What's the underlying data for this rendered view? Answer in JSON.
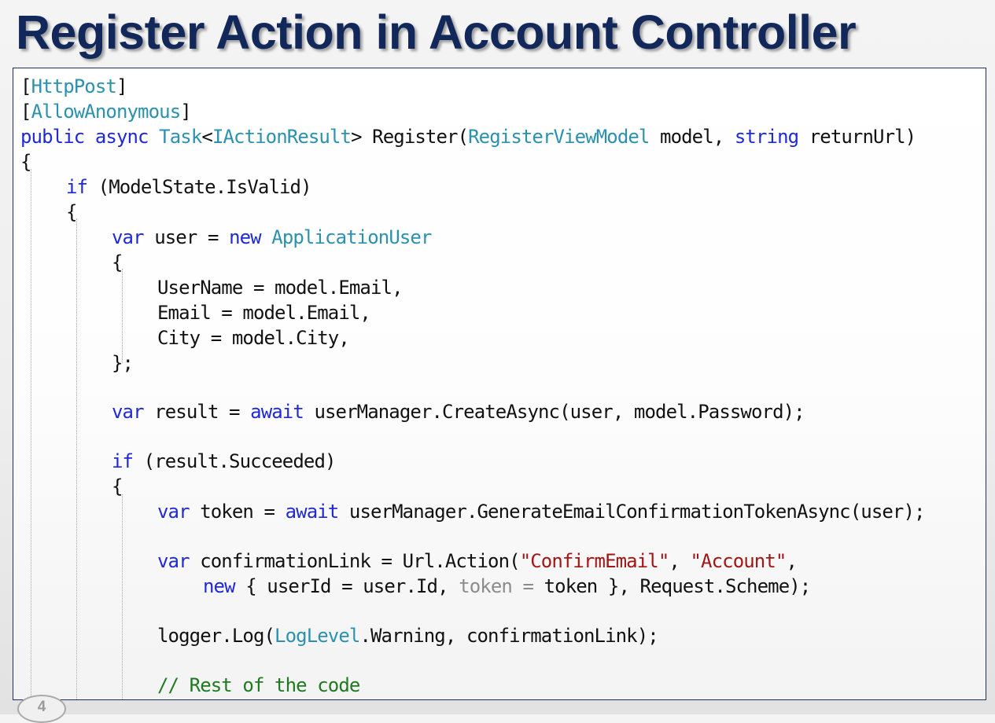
{
  "slide": {
    "title": "Register Action in Account Controller",
    "page_number": "4"
  },
  "colors": {
    "title": "#13285a",
    "keyword": "#1f29d6",
    "type": "#2b91af",
    "string": "#a31515",
    "comment": "#1f7a1f",
    "border": "#1e2f5e"
  },
  "code": {
    "l01": {
      "t1": "[",
      "t2": "HttpPost",
      "t3": "]"
    },
    "l02": {
      "t1": "[",
      "t2": "AllowAnonymous",
      "t3": "]"
    },
    "l03": {
      "t1": "public",
      "t2": " ",
      "t3": "async",
      "t4": " ",
      "t5": "Task",
      "t6": "<",
      "t7": "IActionResult",
      "t8": "> Register(",
      "t9": "RegisterViewModel",
      "t10": " model, ",
      "t11": "string",
      "t12": " returnUrl)"
    },
    "l04": {
      "t1": "{"
    },
    "l05": {
      "t1": "if",
      "t2": " (ModelState.IsValid)"
    },
    "l06": {
      "t1": "{"
    },
    "l07": {
      "t1": "var",
      "t2": " user = ",
      "t3": "new",
      "t4": " ",
      "t5": "ApplicationUser"
    },
    "l08": {
      "t1": "{"
    },
    "l09": {
      "t1": "UserName = model.Email,"
    },
    "l10": {
      "t1": "Email = model.Email,"
    },
    "l11": {
      "t1": "City = model.City,"
    },
    "l12": {
      "t1": "};"
    },
    "l13": {
      "t1": "var",
      "t2": " result = ",
      "t3": "await",
      "t4": " userManager.CreateAsync(user, model.Password);"
    },
    "l14": {
      "t1": "if",
      "t2": " (result.Succeeded)"
    },
    "l15": {
      "t1": "{"
    },
    "l16": {
      "t1": "var",
      "t2": " token = ",
      "t3": "await",
      "t4": " userManager.GenerateEmailConfirmationTokenAsync(user);"
    },
    "l17": {
      "t1": "var",
      "t2": " confirmationLink = Url.Action(",
      "t3": "\"ConfirmEmail\"",
      "t4": ", ",
      "t5": "\"Account\"",
      "t6": ","
    },
    "l18": {
      "t1": "new",
      "t2": " { userId = user.Id, ",
      "t3": "token =",
      "t4": " token }, Request.Scheme);"
    },
    "l19": {
      "t1": "logger.Log(",
      "t2": "LogLevel",
      "t3": ".Warning, confirmationLink);"
    },
    "l20": {
      "t1": "// Rest of the code"
    }
  }
}
